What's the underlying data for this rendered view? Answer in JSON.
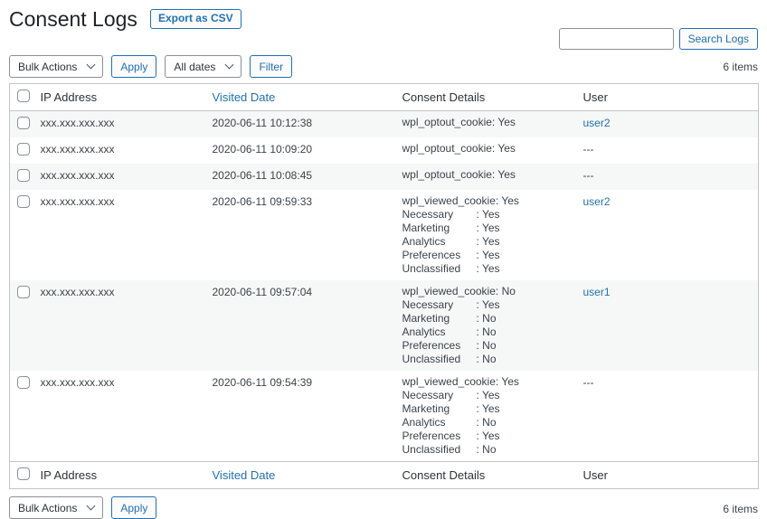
{
  "page": {
    "accent_color": "#2271b1",
    "background_color": "#ffffff",
    "alt_row_color": "#f6f7f7",
    "border_color": "#c3c4c7"
  },
  "header": {
    "title": "Consent Logs",
    "export_button_label": "Export as CSV"
  },
  "search": {
    "value": "",
    "button_label": "Search Logs"
  },
  "toolbar_top": {
    "bulk_actions_label": "Bulk Actions",
    "apply_label": "Apply",
    "dates_filter_label": "All dates",
    "filter_label": "Filter",
    "items_count": "6 items"
  },
  "toolbar_bottom": {
    "bulk_actions_label": "Bulk Actions",
    "apply_label": "Apply",
    "items_count": "6 items"
  },
  "table": {
    "headers": {
      "ip": "IP Address",
      "date": "Visited Date",
      "details": "Consent Details",
      "user": "User"
    },
    "rows": [
      {
        "ip": "xxx.xxx.xxx.xxx",
        "date": "2020-06-11 10:12:38",
        "details": [
          {
            "label": "wpl_optout_cookie",
            "value": "Yes"
          }
        ],
        "user": "user2",
        "user_is_link": true
      },
      {
        "ip": "xxx.xxx.xxx.xxx",
        "date": "2020-06-11 10:09:20",
        "details": [
          {
            "label": "wpl_optout_cookie",
            "value": "Yes"
          }
        ],
        "user": "---",
        "user_is_link": false
      },
      {
        "ip": "xxx.xxx.xxx.xxx",
        "date": "2020-06-11 10:08:45",
        "details": [
          {
            "label": "wpl_optout_cookie",
            "value": "Yes"
          }
        ],
        "user": "---",
        "user_is_link": false
      },
      {
        "ip": "xxx.xxx.xxx.xxx",
        "date": "2020-06-11 09:59:33",
        "details": [
          {
            "label": "wpl_viewed_cookie",
            "value": "Yes"
          },
          {
            "label": "Necessary",
            "value": "Yes"
          },
          {
            "label": "Marketing",
            "value": "Yes"
          },
          {
            "label": "Analytics",
            "value": "Yes"
          },
          {
            "label": "Preferences",
            "value": "Yes"
          },
          {
            "label": "Unclassified",
            "value": "Yes"
          }
        ],
        "user": "user2",
        "user_is_link": true
      },
      {
        "ip": "xxx.xxx.xxx.xxx",
        "date": "2020-06-11 09:57:04",
        "details": [
          {
            "label": "wpl_viewed_cookie",
            "value": "No"
          },
          {
            "label": "Necessary",
            "value": "Yes"
          },
          {
            "label": "Marketing",
            "value": "No"
          },
          {
            "label": "Analytics",
            "value": "No"
          },
          {
            "label": "Preferences",
            "value": "No"
          },
          {
            "label": "Unclassified",
            "value": "No"
          }
        ],
        "user": "user1",
        "user_is_link": true
      },
      {
        "ip": "xxx.xxx.xxx.xxx",
        "date": "2020-06-11 09:54:39",
        "details": [
          {
            "label": "wpl_viewed_cookie",
            "value": "Yes"
          },
          {
            "label": "Necessary",
            "value": "Yes"
          },
          {
            "label": "Marketing",
            "value": "Yes"
          },
          {
            "label": "Analytics",
            "value": "No"
          },
          {
            "label": "Preferences",
            "value": "Yes"
          },
          {
            "label": "Unclassified",
            "value": "No"
          }
        ],
        "user": "---",
        "user_is_link": false
      }
    ]
  }
}
